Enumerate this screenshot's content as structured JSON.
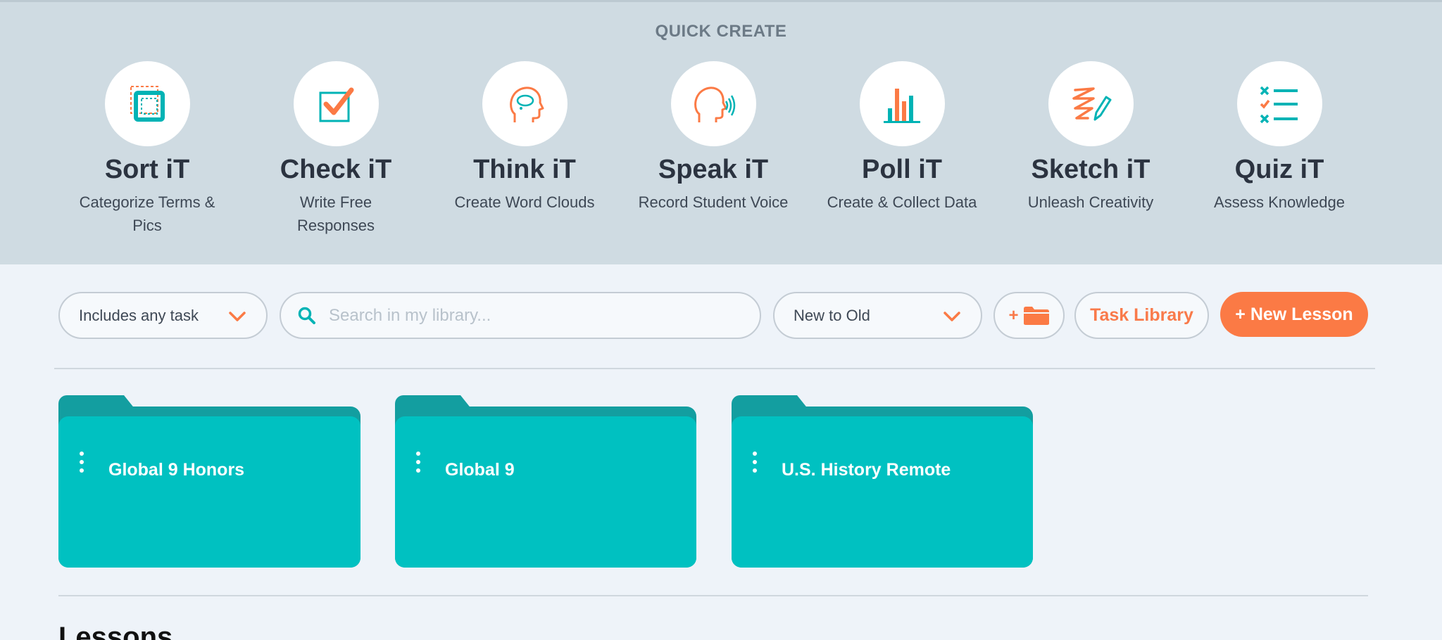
{
  "quick_create": {
    "title": "QUICK CREATE",
    "tiles": [
      {
        "name": "Sort iT",
        "desc": "Categorize Terms & Pics",
        "icon": "sort-icon"
      },
      {
        "name": "Check iT",
        "desc": "Write Free Responses",
        "icon": "checkbox-icon"
      },
      {
        "name": "Think iT",
        "desc": "Create Word Clouds",
        "icon": "head-thought-icon"
      },
      {
        "name": "Speak iT",
        "desc": "Record Student Voice",
        "icon": "head-voice-icon"
      },
      {
        "name": "Poll iT",
        "desc": "Create & Collect Data",
        "icon": "bar-chart-icon"
      },
      {
        "name": "Sketch iT",
        "desc": "Unleash Creativity",
        "icon": "pencil-scribble-icon"
      },
      {
        "name": "Quiz iT",
        "desc": "Assess Knowledge",
        "icon": "checklist-icon"
      }
    ]
  },
  "toolbar": {
    "task_filter": "Includes any task",
    "search_placeholder": "Search in my library...",
    "sort": "New to Old",
    "new_folder_label": "+",
    "task_library": "Task Library",
    "new_lesson": "+ New Lesson"
  },
  "folders": [
    "Global 9 Honors",
    "Global 9",
    "U.S. History Remote"
  ],
  "lessons_heading": "Lessons",
  "colors": {
    "accent_orange": "#fb7a45",
    "accent_teal": "#00c1c1",
    "folder_tab": "#139ea0",
    "band": "#cfdbe2"
  }
}
